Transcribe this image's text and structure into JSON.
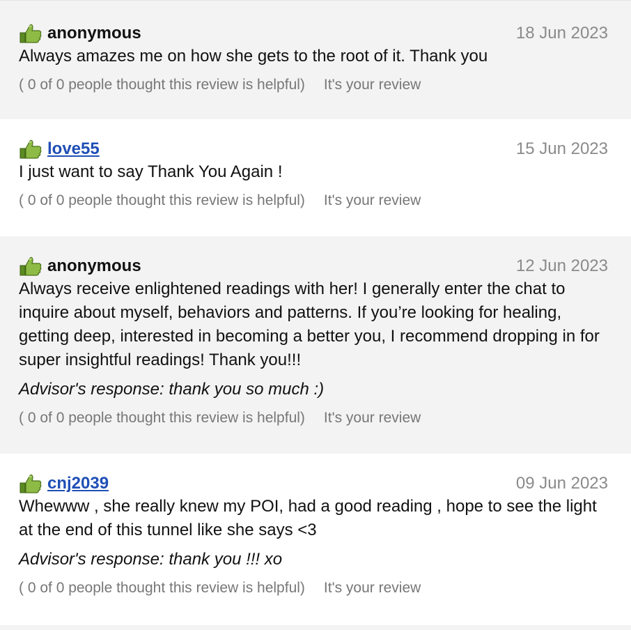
{
  "reviews": [
    {
      "author": "anonymous",
      "author_is_link": false,
      "date": "18 Jun 2023",
      "text": "Always amazes me on how she gets to the root of it. Thank you",
      "response": "",
      "helpful": "( 0 of 0 people thought this review is helpful)",
      "your_review": "It's your review"
    },
    {
      "author": "love55",
      "author_is_link": true,
      "date": "15 Jun 2023",
      "text": "I just want to say Thank You Again !",
      "response": "",
      "helpful": "( 0 of 0 people thought this review is helpful)",
      "your_review": "It's your review"
    },
    {
      "author": "anonymous",
      "author_is_link": false,
      "date": "12 Jun 2023",
      "text": "Always receive enlightened readings with her! I generally enter the chat to inquire about myself, behaviors and patterns. If you’re looking for healing, getting deep, interested in becoming a better you, I recommend dropping in for super insightful readings! Thank you!!!",
      "response": "Advisor's response: thank you so much :)",
      "helpful": "( 0 of 0 people thought this review is helpful)",
      "your_review": "It's your review"
    },
    {
      "author": "cnj2039",
      "author_is_link": true,
      "date": "09 Jun 2023",
      "text": "Whewww , she really knew my POI, had a good reading , hope to see the light at the end of this tunnel like she says <3",
      "response": "Advisor's response: thank you !!! xo",
      "helpful": "( 0 of 0 people thought this review is helpful)",
      "your_review": "It's your review"
    }
  ],
  "icons": {
    "rating": "thumbs-up-icon"
  },
  "colors": {
    "link": "#1f4fb5",
    "muted": "#8a8a8a",
    "shaded_bg": "#f3f3f3",
    "thumb_green": "#7cab38"
  }
}
